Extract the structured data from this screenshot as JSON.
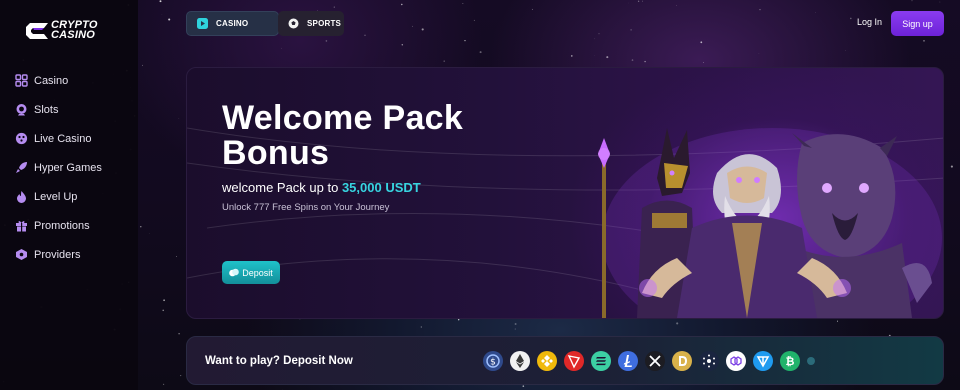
{
  "brand": {
    "line1": "CRYPTO",
    "line2": "CASINO",
    "icon": "logo-c-icon"
  },
  "sidebar": {
    "items": [
      {
        "label": "Casino",
        "icon": "grid-icon"
      },
      {
        "label": "Slots",
        "icon": "cherries-icon"
      },
      {
        "label": "Live Casino",
        "icon": "dealer-icon"
      },
      {
        "label": "Hyper Games",
        "icon": "rocket-icon"
      },
      {
        "label": "Level Up",
        "icon": "flame-icon"
      },
      {
        "label": "Promotions",
        "icon": "gift-icon"
      },
      {
        "label": "Providers",
        "icon": "joystick-icon"
      }
    ]
  },
  "topbar": {
    "tabs": [
      {
        "label": "CASINO",
        "icon": "play-icon"
      },
      {
        "label": "SPORTS",
        "icon": "ball-icon"
      }
    ],
    "login_label": "Log In",
    "signup_label": "Sign up"
  },
  "banner": {
    "title_line1": "Welcome Pack",
    "title_line2": "Bonus",
    "subtitle_prefix": "welcome Pack up to ",
    "subtitle_highlight": "35,000 USDT",
    "note": "Unlock 777 Free Spins on Your Journey",
    "deposit_label": "Deposit"
  },
  "paybar": {
    "text": "Want to play? Deposit Now",
    "coins": [
      {
        "name": "usdc-coin-icon",
        "color": "#2f4a8c"
      },
      {
        "name": "ethereum-coin-icon",
        "color": "#f2f2f2"
      },
      {
        "name": "bnb-coin-icon",
        "color": "#f0b90b"
      },
      {
        "name": "tron-coin-icon",
        "color": "#e02828"
      },
      {
        "name": "solana-coin-icon",
        "color": "#3ccfa3"
      },
      {
        "name": "litecoin-coin-icon",
        "color": "#3f6ee0"
      },
      {
        "name": "xrp-coin-icon",
        "color": "#1c1c22"
      },
      {
        "name": "dogecoin-coin-icon",
        "color": "#d9b24a"
      },
      {
        "name": "cardano-coin-icon",
        "color": "#1a2540"
      },
      {
        "name": "polygon-coin-icon",
        "color": "#ffffff"
      },
      {
        "name": "toncoin-coin-icon",
        "color": "#1f9bf0"
      },
      {
        "name": "bitcoin-cash-coin-icon",
        "color": "#20b36b"
      },
      {
        "name": "partial-coin-icon",
        "color": "#2b6b7a"
      }
    ]
  },
  "colors": {
    "accent": "#7c2fe6",
    "teal": "#1bb3bd",
    "highlight": "#37d4e0"
  }
}
